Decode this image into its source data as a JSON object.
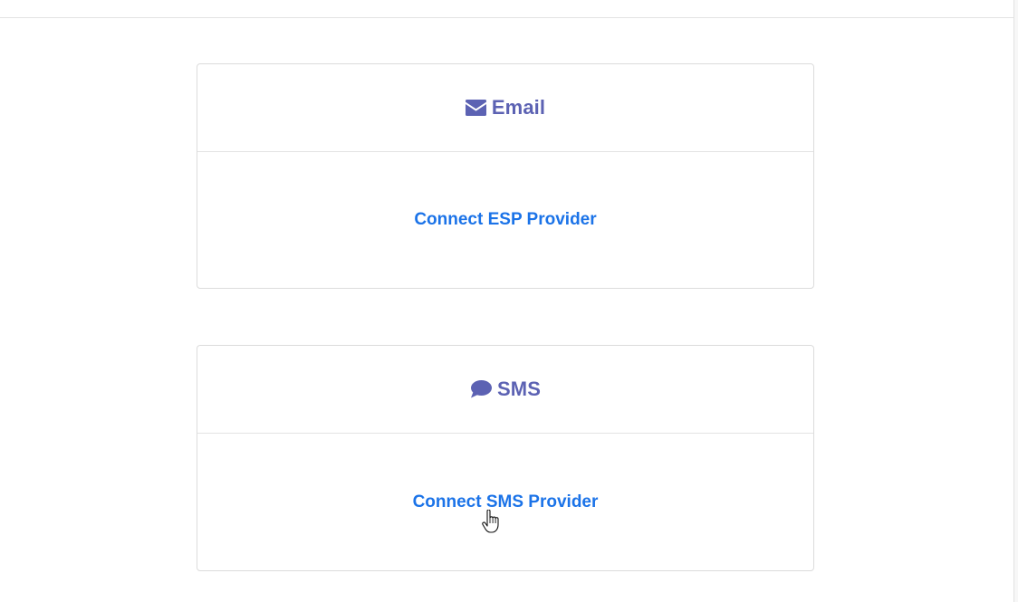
{
  "email_card": {
    "icon": "envelope-icon",
    "title": "Email",
    "action_label": "Connect ESP Provider"
  },
  "sms_card": {
    "icon": "chat-bubble-icon",
    "title": "SMS",
    "action_label": "Connect SMS Provider"
  },
  "colors": {
    "header_accent": "#5c62b3",
    "link": "#1b73e8",
    "border": "#dcdcdc"
  }
}
